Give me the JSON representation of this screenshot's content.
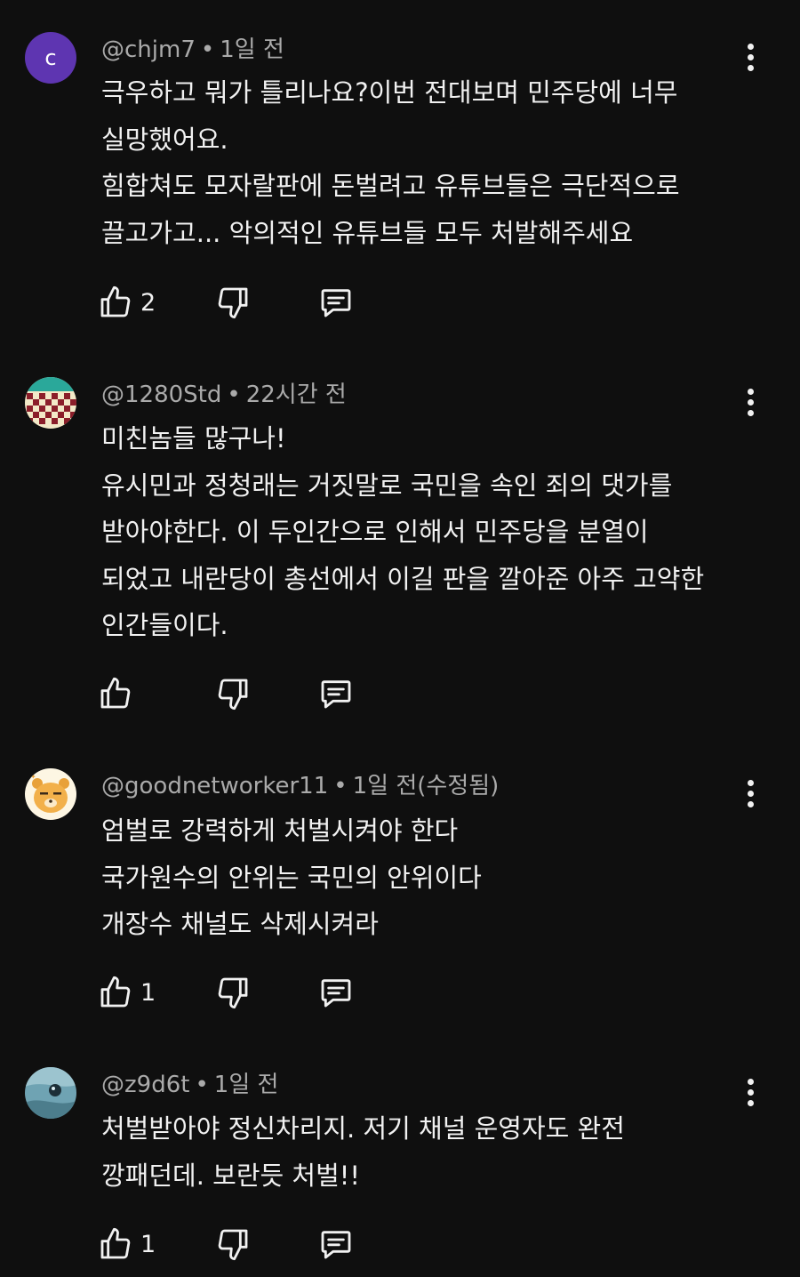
{
  "comments": [
    {
      "handle": "@chjm7",
      "time": "1일 전",
      "avatar_letter": "c",
      "avatar_color": "#5e35b1",
      "lines": [
        "극우하고 뭐가 틀리나요?이번 전대보며 민주당에 너무",
        "실망했어요.",
        "힘합쳐도 모자랄판에 돈벌려고 유튜브들은 극단적으로",
        "끌고가고... 악의적인 유튜브들 모두 처발해주세요"
      ],
      "likes": "2"
    },
    {
      "handle": "@1280Std",
      "time": "22시간 전",
      "avatar_icon": "checkered-avatar-icon",
      "lines": [
        "미친놈들 많구나!",
        "유시민과 정청래는 거짓말로 국민을 속인 죄의 댓가를",
        "받아야한다. 이 두인간으로 인해서 민주당을 분열이",
        "되었고 내란당이 총선에서 이길 판을 깔아준 아주 고약한",
        "인간들이다."
      ],
      "likes": ""
    },
    {
      "handle": "@goodnetworker11",
      "time": "1일 전(수정됨)",
      "avatar_icon": "lion-character-avatar-icon",
      "lines": [
        "엄벌로 강력하게 처벌시켜야 한다",
        "국가원수의 안위는 국민의 안위이다",
        "개장수 채널도 삭제시켜라"
      ],
      "likes": "1"
    },
    {
      "handle": "@z9d6t",
      "time": "1일 전",
      "avatar_icon": "photo-avatar-icon",
      "lines": [
        "처벌받아야 정신차리지. 저기 채널 운영자도 완전",
        "깡패던데. 보란듯 처벌!!"
      ],
      "likes": "1"
    }
  ],
  "icons": {
    "like": "thumbs-up-icon",
    "dislike": "thumbs-down-icon",
    "reply": "reply-comment-icon",
    "menu": "more-vertical-icon"
  },
  "colors": {
    "background": "#0f0f0f",
    "text": "#f1f1f1",
    "meta": "#aaaaaa"
  }
}
